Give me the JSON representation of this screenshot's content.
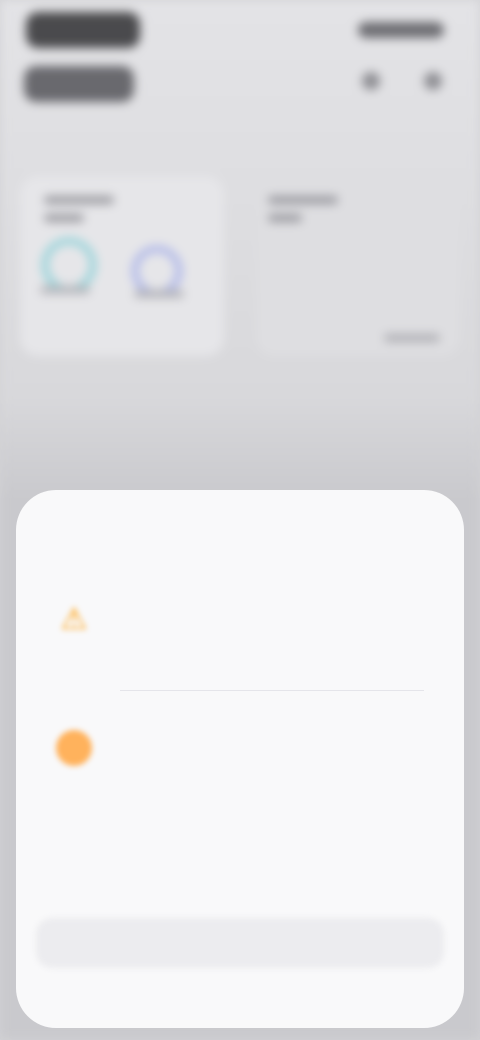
{
  "sheet": {
    "title": "",
    "features": [
      {
        "icon": "warning-icon",
        "heading": "",
        "description": ""
      },
      {
        "icon": "badge-icon",
        "heading": "",
        "description": ""
      }
    ],
    "footnote": "",
    "primary_button_label": ""
  },
  "colors": {
    "sheet_background": "#f9f9fa",
    "dim_background": "#d3d3d6",
    "accent_orange": "#ff9f0a",
    "ring_teal": "#8fd1d8",
    "ring_blue": "#a9b2e8"
  }
}
